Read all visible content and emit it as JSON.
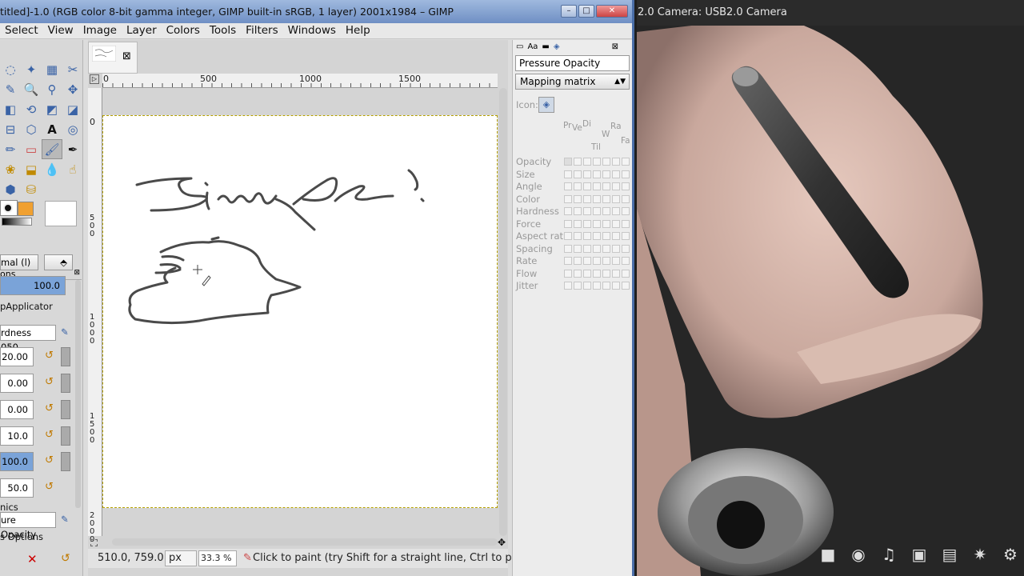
{
  "gimp": {
    "title": "titled]-1.0 (RGB color 8-bit gamma integer, GIMP built-in sRGB, 1 layer) 2001x1984 – GIMP",
    "menu": [
      "Select",
      "View",
      "Image",
      "Layer",
      "Colors",
      "Tools",
      "Filters",
      "Windows",
      "Help"
    ],
    "tool_options": {
      "panel_label": "ons",
      "mode": "mal (l)",
      "opacity": "100.0",
      "brush_label": "pApplicator",
      "brush_name": "rdness 050",
      "size": "20.00",
      "aspect_ratio": "0.00",
      "angle": "0.00",
      "spacing": "10.0",
      "hardness": "100.0",
      "force": "50.0",
      "dynamics_label": "nics",
      "dynamics": "ure Opacity",
      "dynamics_options": "s Options"
    },
    "rulers": {
      "h": [
        "0",
        "500",
        "1000",
        "1500"
      ],
      "v": [
        "0",
        "5\n0\n0",
        "1\n0\n0\n0",
        "1\n5\n0\n0",
        "2\n0\n0\n0"
      ]
    },
    "status": {
      "coords": "510.0, 759.0",
      "unit": "px",
      "zoom": "33.3 %",
      "message": "Click to paint (try Shift for a straight line, Ctrl to p..."
    },
    "dynamics_editor": {
      "name": "Pressure Opacity",
      "mapping": "Mapping matrix",
      "icon_label": "Icon:",
      "columns": [
        "Pr",
        "Ve",
        "Di",
        "Til",
        "W",
        "Ra",
        "Fa"
      ],
      "rows": [
        "Opacity",
        "Size",
        "Angle",
        "Color",
        "Hardness",
        "Force",
        "Aspect ratio",
        "Spacing",
        "Rate",
        "Flow",
        "Jitter"
      ]
    }
  },
  "camera": {
    "title": "2.0 Camera: USB2.0 Camera",
    "icons": [
      "square-icon",
      "camera-lens-icon",
      "music-icon",
      "photo-icon",
      "film-icon",
      "effects-icon",
      "gear-icon"
    ]
  }
}
